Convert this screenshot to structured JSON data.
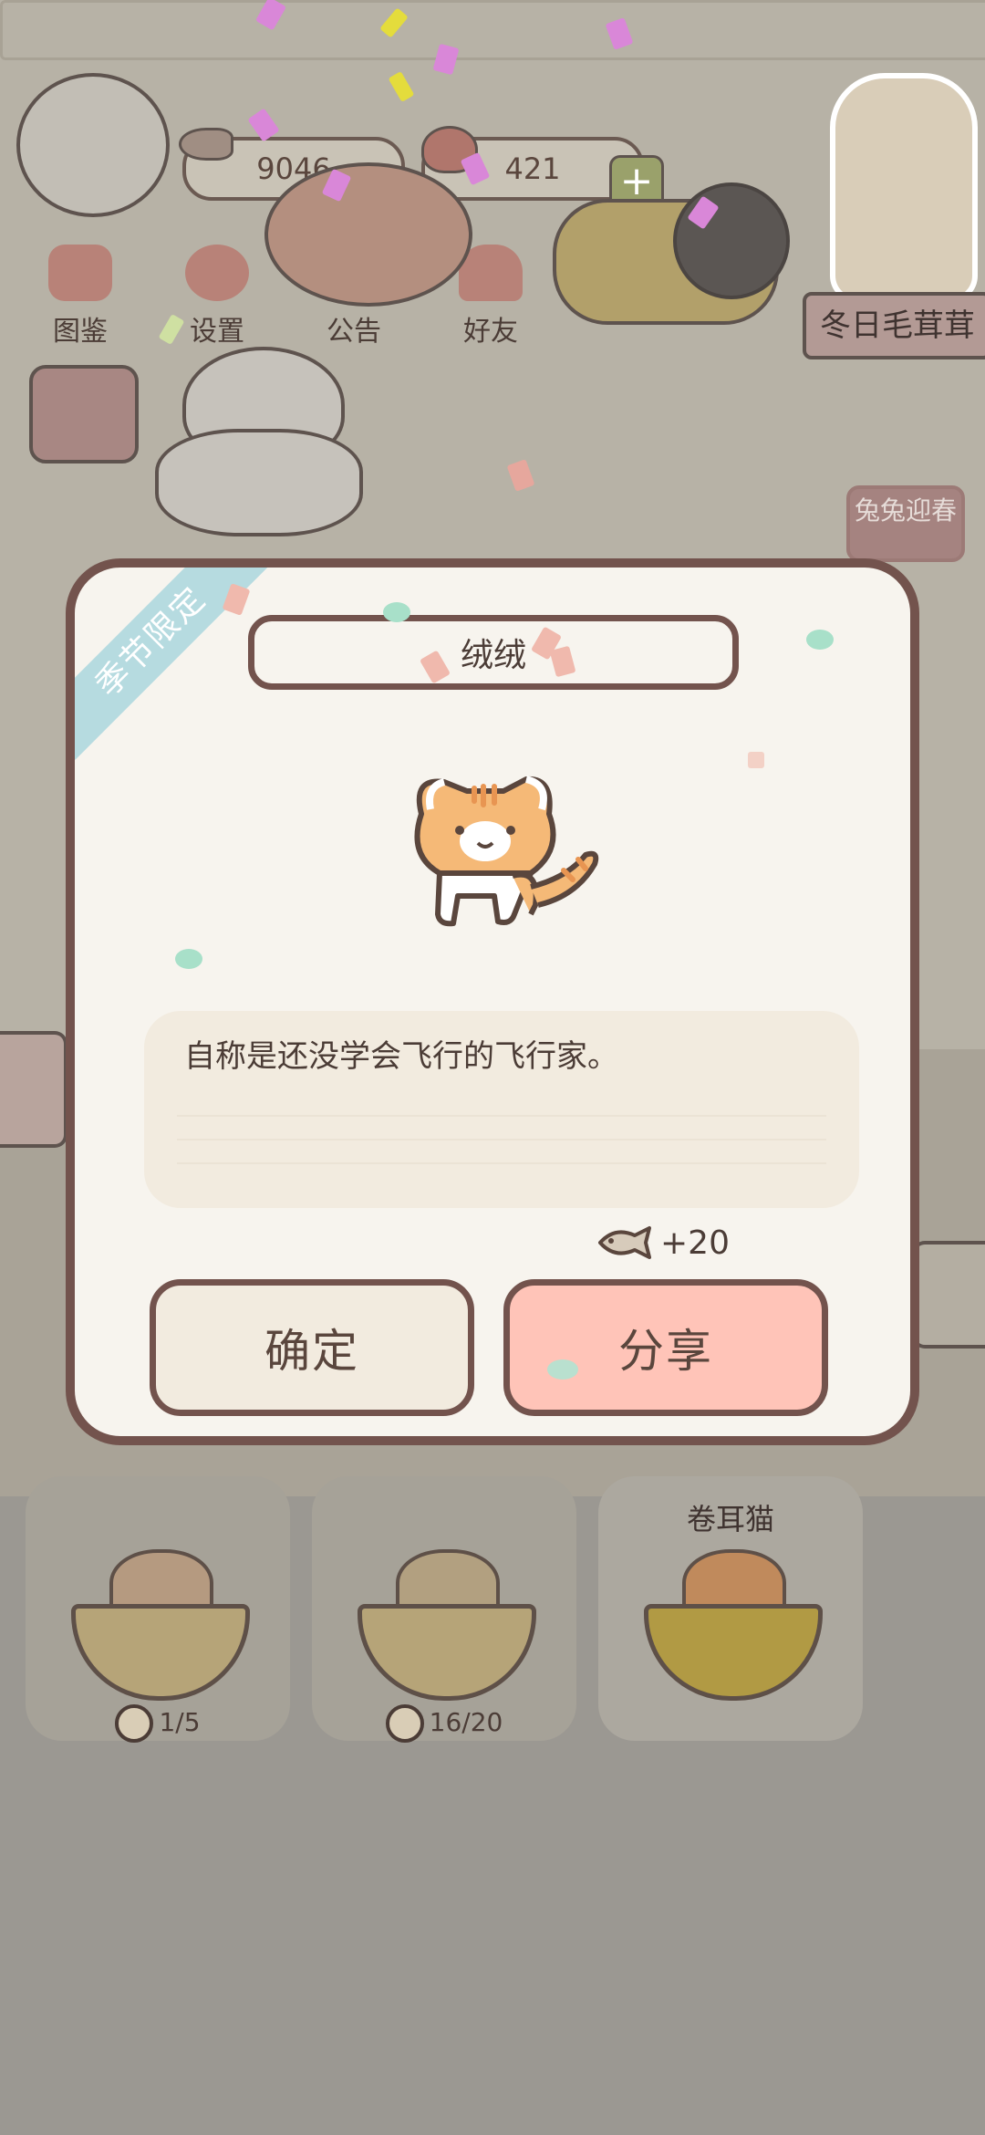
{
  "hud": {
    "fish_count": "9046",
    "heart_count": "421"
  },
  "menu": {
    "items": [
      {
        "label": "图鉴",
        "icon": "cat-head-icon"
      },
      {
        "label": "设置",
        "icon": "gear-icon"
      },
      {
        "label": "公告",
        "icon": "gift-icon"
      },
      {
        "label": "好友",
        "icon": "friends-icon"
      }
    ]
  },
  "event_banners": {
    "winter": "冬日毛茸茸",
    "rabbit": "兔兔迎春"
  },
  "dialog": {
    "ribbon": "季节限定",
    "cat_name": "绒绒",
    "description": "自称是还没学会飞行的飞行家。",
    "reward": "+20",
    "confirm_label": "确定",
    "share_label": "分享"
  },
  "cards": [
    {
      "name": "",
      "count": "1/5"
    },
    {
      "name": "",
      "count": "16/20"
    },
    {
      "name": "卷耳猫",
      "count": ""
    }
  ],
  "colors": {
    "dialog_border": "#73534d",
    "share_button": "#ffc4b8",
    "ribbon": "#b6dbe0"
  }
}
